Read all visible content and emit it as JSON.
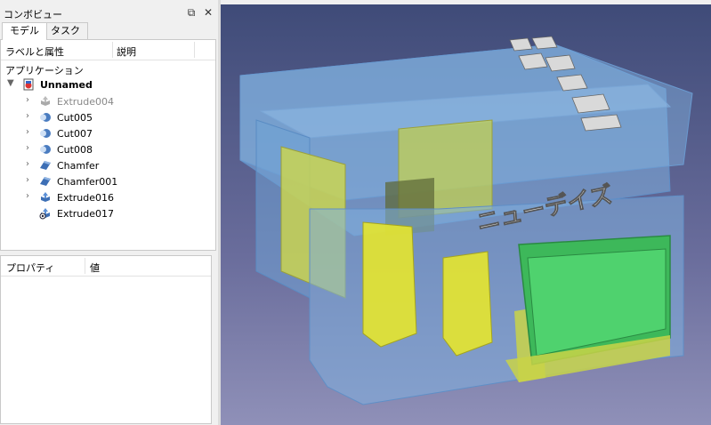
{
  "panel": {
    "title": "コンボビュー",
    "float_glyph": "⧉",
    "close_glyph": "✕"
  },
  "tabs": [
    {
      "label": "モデル",
      "active": true
    },
    {
      "label": "タスク",
      "active": false
    }
  ],
  "tree": {
    "col_labels": "ラベルと属性",
    "col_desc": "説明",
    "root_section": "アプリケーション",
    "document": "Unnamed",
    "items": [
      {
        "label": "Extrude004",
        "icon": "extrude-icon",
        "dim": true
      },
      {
        "label": "Cut005",
        "icon": "cut-icon",
        "dim": false
      },
      {
        "label": "Cut007",
        "icon": "cut-icon",
        "dim": false
      },
      {
        "label": "Cut008",
        "icon": "cut-icon",
        "dim": false
      },
      {
        "label": "Chamfer",
        "icon": "chamfer-icon",
        "dim": false
      },
      {
        "label": "Chamfer001",
        "icon": "chamfer-icon",
        "dim": false
      },
      {
        "label": "Extrude016",
        "icon": "extrude-icon",
        "dim": false
      },
      {
        "label": "Extrude017",
        "icon": "extrude-visible-icon",
        "dim": false
      }
    ]
  },
  "properties": {
    "col_property": "プロパティ",
    "col_value": "値"
  },
  "viewport": {
    "text3d": "ニューデイズ",
    "colors": {
      "shell": "#7fb0e0",
      "yellow": "#d8e24a",
      "screen": "#4fd26e",
      "background_top": "#3f4b78",
      "background_bottom": "#8f90b8"
    }
  }
}
